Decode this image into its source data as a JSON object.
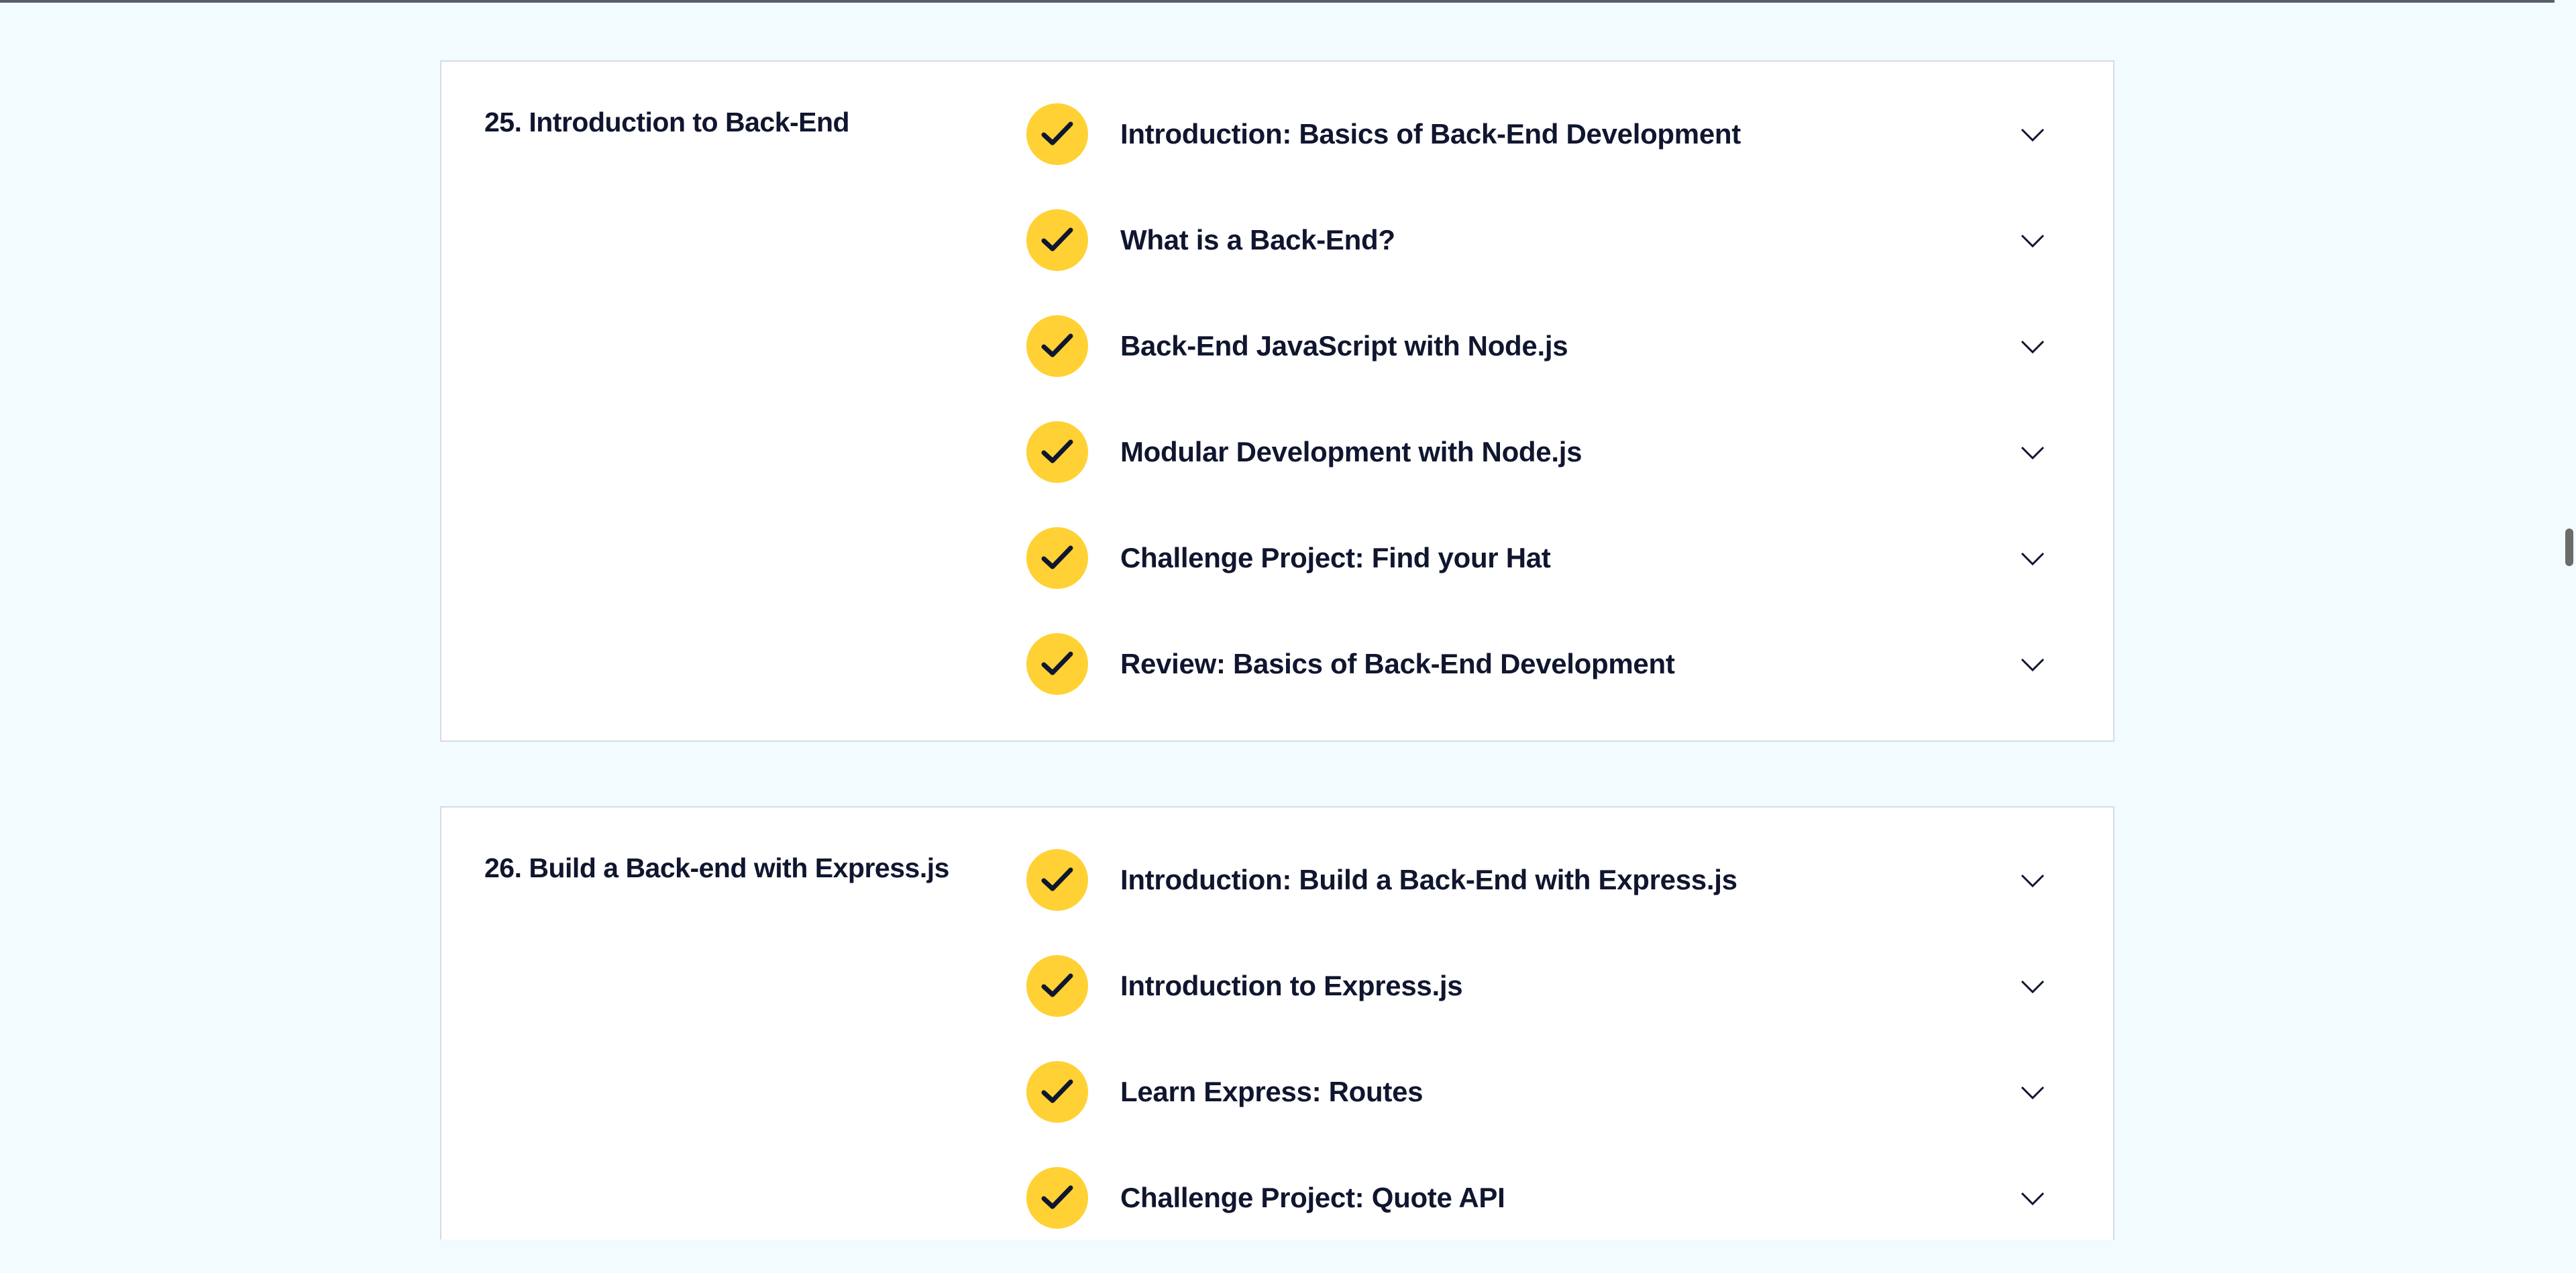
{
  "colors": {
    "page_background": "#f2fbff",
    "card_background": "#ffffff",
    "card_border": "#d7dbe3",
    "check_badge": "#ffd134",
    "text": "#10162f"
  },
  "icons": {
    "lesson_status": "check-icon",
    "expand": "chevron-down-icon"
  },
  "modules": [
    {
      "title": "25. Introduction to Back-End",
      "lessons": [
        {
          "title": "Introduction: Basics of Back-End Development",
          "completed": true
        },
        {
          "title": "What is a Back-End?",
          "completed": true
        },
        {
          "title": "Back-End JavaScript with Node.js",
          "completed": true
        },
        {
          "title": "Modular Development with Node.js",
          "completed": true
        },
        {
          "title": "Challenge Project: Find your Hat",
          "completed": true
        },
        {
          "title": "Review: Basics of Back-End Development",
          "completed": true
        }
      ]
    },
    {
      "title": "26. Build a Back-end with Express.js",
      "lessons": [
        {
          "title": "Introduction: Build a Back-End with Express.js",
          "completed": true
        },
        {
          "title": "Introduction to Express.js",
          "completed": true
        },
        {
          "title": "Learn Express: Routes",
          "completed": true
        },
        {
          "title": "Challenge Project: Quote API",
          "completed": true
        }
      ]
    }
  ]
}
